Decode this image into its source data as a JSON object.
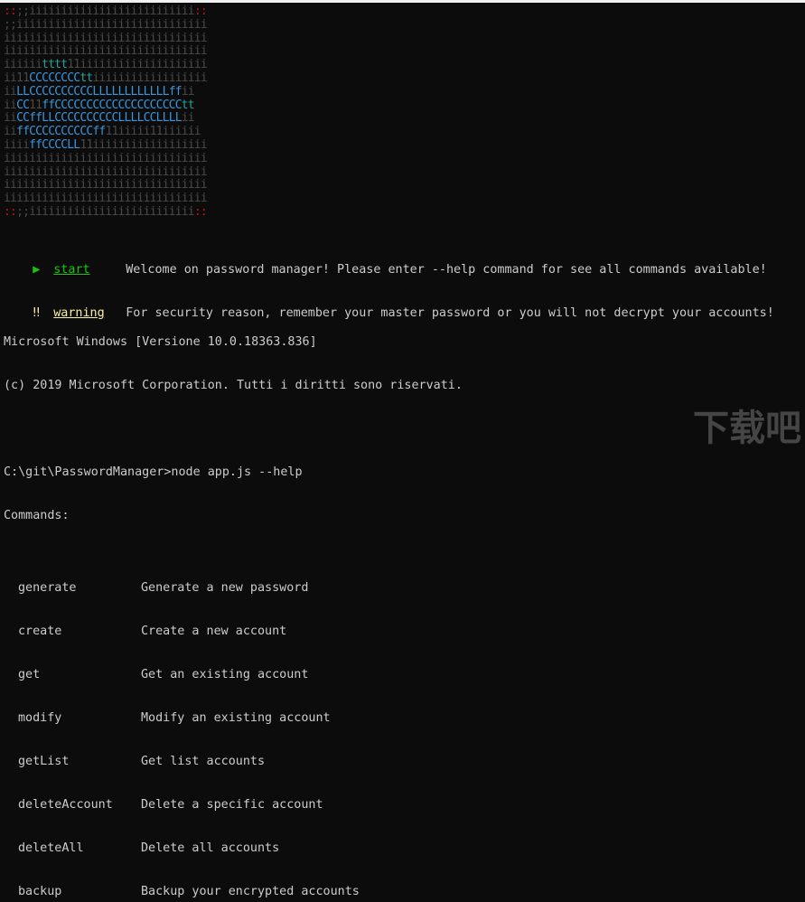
{
  "theme": {
    "background": "#0c0c0c",
    "text": "#cccccc",
    "success": "#16c60c",
    "warning": "#f9f1a5",
    "art_dim": "#4a4a4a",
    "art_red": "#c50f1f",
    "art_blue": "#3a96dd",
    "art_cyan": "#2aa198"
  },
  "ascii_art": {
    "rows": [
      [
        {
          "t": "::",
          "c": "red"
        },
        {
          "t": ";;iiiiiiiiiiiiiiiiiiiiiiiiii",
          "c": "dim"
        },
        {
          "t": "::",
          "c": "red"
        }
      ],
      [
        {
          "t": ";;iiiiiiiiiiiiiiiiiiiiiiiiiiiiii",
          "c": "dim"
        }
      ],
      [
        {
          "t": "iiiiiiiiiiiiiiiiiiiiiiiiiiiiiiii",
          "c": "dim"
        }
      ],
      [
        {
          "t": "iiiiiiiiiiiiiiiiiiiiiiiiiiiiiiii",
          "c": "dim"
        }
      ],
      [
        {
          "t": "iiiiii",
          "c": "dim"
        },
        {
          "t": "tttt",
          "c": "cyan"
        },
        {
          "t": "11iiiiiiiiiiiiiiiiiiii",
          "c": "dim"
        }
      ],
      [
        {
          "t": "ii11",
          "c": "dim"
        },
        {
          "t": "CCCCCCCC",
          "c": "blue"
        },
        {
          "t": "tt",
          "c": "cyan"
        },
        {
          "t": "iiiiiiiiiiiiiiiiii",
          "c": "dim"
        }
      ],
      [
        {
          "t": "ii",
          "c": "dim"
        },
        {
          "t": "LLCCCCCCCCCCLLLLLLLLLLLLff",
          "c": "blue"
        },
        {
          "t": "ii",
          "c": "dim"
        }
      ],
      [
        {
          "t": "ii",
          "c": "dim"
        },
        {
          "t": "CC",
          "c": "blue"
        },
        {
          "t": "11",
          "c": "dim"
        },
        {
          "t": "ffCCCCCCCCCCCCCCCCCCCC",
          "c": "blue"
        },
        {
          "t": "tt",
          "c": "cyan"
        }
      ],
      [
        {
          "t": "ii",
          "c": "dim"
        },
        {
          "t": "CCffLLCCCCCCCCCCLLLLCCLLLL",
          "c": "blue"
        },
        {
          "t": "ii",
          "c": "dim"
        }
      ],
      [
        {
          "t": "ii",
          "c": "dim"
        },
        {
          "t": "ffCCCCCCCCCCff",
          "c": "blue"
        },
        {
          "t": "11iiiii11iiiiii",
          "c": "dim"
        }
      ],
      [
        {
          "t": "iiii",
          "c": "dim"
        },
        {
          "t": "ffCCCCLL",
          "c": "blue"
        },
        {
          "t": "11iiiiiiiiiiiiiiiiii",
          "c": "dim"
        }
      ],
      [
        {
          "t": "iiiiiiiiiiiiiiiiiiiiiiiiiiiiiiii",
          "c": "dim"
        }
      ],
      [
        {
          "t": "iiiiiiiiiiiiiiiiiiiiiiiiiiiiiiii",
          "c": "dim"
        }
      ],
      [
        {
          "t": "iiiiiiiiiiiiiiiiiiiiiiiiiiiiiiii",
          "c": "dim"
        }
      ],
      [
        {
          "t": "iiiiiiiiiiiiiiiiiiiiiiiiiiiiiiii",
          "c": "dim"
        }
      ],
      [
        {
          "t": "::",
          "c": "red"
        },
        {
          "t": ";;iiiiiiiiiiiiiiiiiiiiiiiiii",
          "c": "dim"
        },
        {
          "t": "::",
          "c": "red"
        }
      ]
    ]
  },
  "logs": [
    {
      "icon": "▶",
      "tag": "start",
      "message": "Welcome on password manager! Please enter --help command for see all commands available!",
      "color": "#16c60c"
    },
    {
      "icon": "‼",
      "tag": "warning",
      "message": "For security reason, remember your master password or you will not decrypt your accounts!",
      "color": "#f9f1a5"
    }
  ],
  "header_lines": [
    "Microsoft Windows [Versione 10.0.18363.836]",
    "(c) 2019 Microsoft Corporation. Tutti i diritti sono riservati."
  ],
  "prompt": "C:\\git\\PasswordManager>node app.js --help",
  "commands_heading": "Commands:",
  "commands": [
    {
      "name": "generate",
      "desc": "Generate a new password"
    },
    {
      "name": "create",
      "desc": "Create a new account"
    },
    {
      "name": "get",
      "desc": "Get an existing account"
    },
    {
      "name": "modify",
      "desc": "Modify an existing account"
    },
    {
      "name": "getList",
      "desc": "Get list accounts"
    },
    {
      "name": "deleteAccount",
      "desc": "Delete a specific account"
    },
    {
      "name": "deleteAll",
      "desc": "Delete all accounts"
    },
    {
      "name": "backup",
      "desc": "Backup your encrypted accounts"
    }
  ],
  "watermark": "下载吧"
}
